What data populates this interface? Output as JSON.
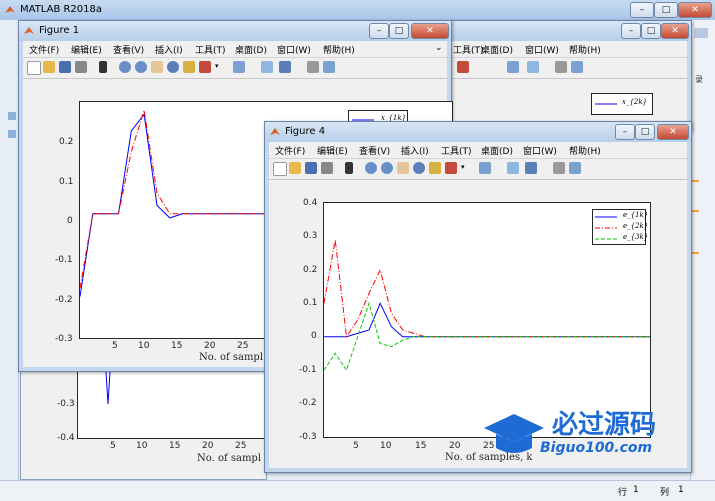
{
  "app": {
    "title": "MATLAB R2018a",
    "status_row_label": "行",
    "status_row_value": "1",
    "status_col_label": "列",
    "status_col_value": "1",
    "watermark_text": "必过源码",
    "watermark_url": "Biguo100.com"
  },
  "menus": [
    "文件(F)",
    "编辑(E)",
    "查看(V)",
    "插入(I)",
    "工具(T)",
    "桌面(D)",
    "窗口(W)",
    "帮助(H)"
  ],
  "back_menus": [
    "工具(T)",
    "桌面(D)",
    "窗口(W)",
    "帮助(H)"
  ],
  "figure1": {
    "title": "Figure 1",
    "xlabel": "No. of sampl",
    "legend": [
      "x_{1k}"
    ],
    "y_ticks": [
      "0.2",
      "0.1",
      "0",
      "-0.1",
      "-0.2",
      "-0.3"
    ],
    "x_ticks": [
      "5",
      "10",
      "15",
      "20",
      "25"
    ],
    "lower_xlabel": "No. of sampl",
    "lower_y_ticks": [
      "-0.3",
      "-0.4"
    ],
    "lower_x_ticks": [
      "5",
      "10",
      "15",
      "20",
      "25"
    ]
  },
  "figure2": {
    "legend": [
      "x_{2k}"
    ]
  },
  "figure4": {
    "title": "Figure 4",
    "xlabel": "No. of samples, k",
    "y_ticks": [
      "0.4",
      "0.3",
      "0.2",
      "0.1",
      "0",
      "-0.1",
      "-0.2",
      "-0.3"
    ],
    "x_ticks": [
      "5",
      "10",
      "15",
      "20",
      "25"
    ],
    "legend": [
      "e_{1k}",
      "e_{2k}",
      "e_{3k}"
    ]
  },
  "chart_data": [
    {
      "type": "line",
      "title": "",
      "xlabel": "No. of sampl",
      "ylabel": "",
      "xlim": [
        1,
        30
      ],
      "ylim": [
        -0.3,
        0.27
      ],
      "series": [
        {
          "name": "x_{1k}",
          "color": "#0000ff",
          "style": "solid",
          "x": [
            1,
            2,
            3,
            4,
            5,
            6,
            7,
            8,
            9,
            10,
            15,
            20,
            25,
            30
          ],
          "y": [
            -0.2,
            0,
            0,
            0,
            0.2,
            0.24,
            0.02,
            -0.01,
            0,
            0,
            0,
            0,
            0,
            0
          ]
        },
        {
          "color": "#ff0000",
          "style": "dashdot",
          "x": [
            1,
            2,
            3,
            4,
            5,
            6,
            7,
            8,
            9,
            10,
            15,
            20,
            25,
            30
          ],
          "y": [
            -0.18,
            0,
            0,
            0,
            0.15,
            0.25,
            0.05,
            0,
            0,
            0,
            0,
            0,
            0,
            0
          ]
        }
      ]
    },
    {
      "type": "line",
      "title": "",
      "xlabel": "No. of samples, k",
      "ylabel": "",
      "xlim": [
        1,
        30
      ],
      "ylim": [
        -0.3,
        0.4
      ],
      "series": [
        {
          "name": "e_{1k}",
          "color": "#0000ff",
          "style": "solid",
          "x": [
            1,
            2,
            3,
            4,
            5,
            6,
            7,
            8,
            9,
            10,
            12,
            15,
            17,
            20,
            25,
            30
          ],
          "y": [
            0,
            0,
            0,
            0.01,
            0.02,
            0.1,
            0.03,
            0,
            0,
            0,
            0,
            0,
            0,
            0,
            0,
            0
          ]
        },
        {
          "name": "e_{2k}",
          "color": "#ff0000",
          "style": "dashdot",
          "x": [
            1,
            2,
            3,
            4,
            5,
            6,
            7,
            8,
            9,
            10,
            12,
            15,
            17,
            20,
            25,
            30
          ],
          "y": [
            0.1,
            0.29,
            0.0,
            0.05,
            0.13,
            0.2,
            0.07,
            0.02,
            0.01,
            0,
            0,
            0,
            0,
            0,
            0,
            0
          ]
        },
        {
          "name": "e_{3k}",
          "color": "#00cc00",
          "style": "dashed",
          "x": [
            1,
            2,
            3,
            4,
            5,
            6,
            7,
            8,
            9,
            10,
            12,
            15,
            17,
            20,
            25,
            30
          ],
          "y": [
            -0.1,
            -0.05,
            -0.1,
            0.0,
            0.1,
            -0.02,
            -0.03,
            -0.01,
            0,
            0,
            0,
            0,
            0,
            0,
            0,
            0
          ]
        }
      ]
    }
  ]
}
